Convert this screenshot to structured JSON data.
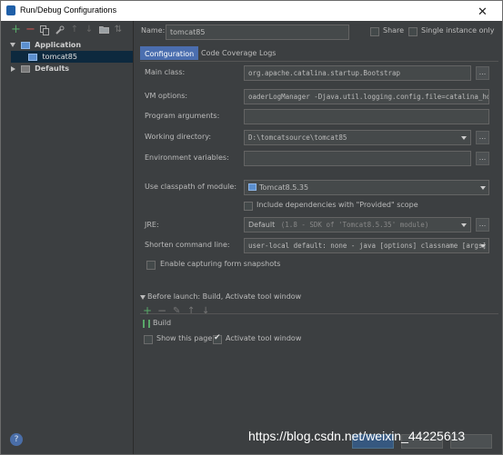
{
  "window": {
    "title": "Run/Debug Configurations",
    "close_glyph": "✕"
  },
  "left_toolbar": {
    "add": "+",
    "remove": "−"
  },
  "tree": {
    "application": "Application",
    "tomcat": "tomcat85",
    "defaults": "Defaults"
  },
  "header": {
    "name_label": "Name:",
    "name_value": "tomcat85",
    "share_label": "Share",
    "single_instance_label": "Single instance only"
  },
  "tabs": [
    "Configuration",
    "Code Coverage",
    "Logs"
  ],
  "config": {
    "main_class_label": "Main class:",
    "main_class_value": "org.apache.catalina.startup.Bootstrap",
    "vm_options_label": "VM options:",
    "vm_options_value": "oaderLogManager -Djava.util.logging.config.file=catalina_home",
    "program_args_label": "Program arguments:",
    "program_args_value": "",
    "working_dir_label": "Working directory:",
    "working_dir_value": "D:\\tomcatsource\\tomcat85",
    "env_vars_label": "Environment variables:",
    "env_vars_value": "",
    "classpath_label": "Use classpath of module:",
    "classpath_value": "Tomcat8.5.35",
    "include_deps_label": "Include dependencies with \"Provided\" scope",
    "jre_label": "JRE:",
    "jre_value": "Default",
    "jre_hint": "(1.8 - SDK of 'Tomcat8.5.35' module)",
    "shorten_label": "Shorten command line:",
    "shorten_value": "user-local default: none - java [options] classname [args]",
    "snapshots_label": "Enable capturing form snapshots",
    "dots": "..."
  },
  "before_launch": {
    "header": "Before launch: Build, Activate tool window",
    "task": "Build",
    "show_page_label": "Show this page",
    "activate_label": "Activate tool window"
  },
  "footer": {
    "help": "?",
    "watermark": "https://blog.csdn.net/weixin_44225613"
  },
  "colors": {
    "accent": "#4b6eaf",
    "green": "#59a869",
    "background": "#3c3f41"
  }
}
